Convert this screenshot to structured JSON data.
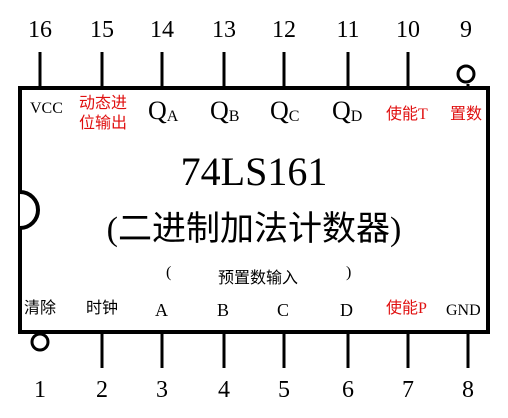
{
  "chip": {
    "part_number": "74LS161",
    "description": "(二进制加法计数器)",
    "preset_label_open": "(",
    "preset_label": "预置数输入",
    "preset_label_close": ")"
  },
  "top_pins": [
    {
      "number": "16",
      "label": "VCC"
    },
    {
      "number": "15",
      "label_line1": "动态进",
      "label_line2": "位输出"
    },
    {
      "number": "14",
      "label_main": "Q",
      "label_sub": "A"
    },
    {
      "number": "13",
      "label_main": "Q",
      "label_sub": "B"
    },
    {
      "number": "12",
      "label_main": "Q",
      "label_sub": "C"
    },
    {
      "number": "11",
      "label_main": "Q",
      "label_sub": "D"
    },
    {
      "number": "10",
      "label": "使能T"
    },
    {
      "number": "9",
      "label": "置数"
    }
  ],
  "bottom_pins": [
    {
      "number": "1",
      "label": "清除"
    },
    {
      "number": "2",
      "label": "时钟"
    },
    {
      "number": "3",
      "label": "A"
    },
    {
      "number": "4",
      "label": "B"
    },
    {
      "number": "5",
      "label": "C"
    },
    {
      "number": "6",
      "label": "D"
    },
    {
      "number": "7",
      "label": "使能P"
    },
    {
      "number": "8",
      "label": "GND"
    }
  ],
  "colors": {
    "outline": "#000000",
    "highlight_label": "#e01010",
    "background": "#ffffff"
  }
}
